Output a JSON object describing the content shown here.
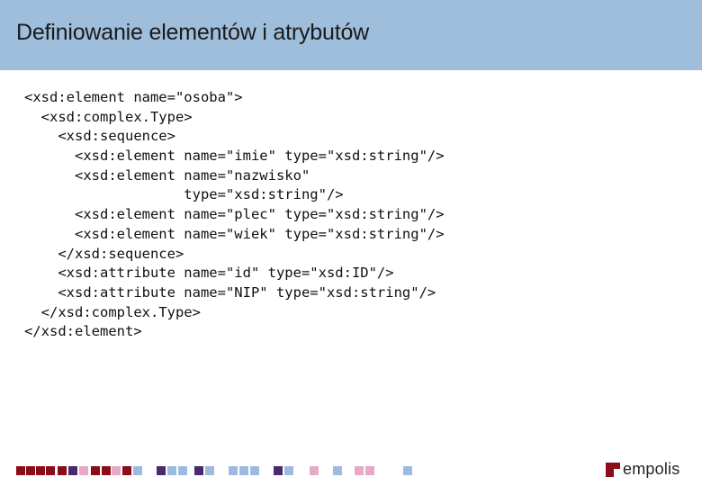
{
  "slide": {
    "title": "Definiowanie elementów i atrybutów",
    "code_lines": [
      "<xsd:element name=\"osoba\">",
      "  <xsd:complex.Type>",
      "    <xsd:sequence>",
      "      <xsd:element name=\"imie\" type=\"xsd:string\"/>",
      "      <xsd:element name=\"nazwisko\"",
      "                   type=\"xsd:string\"/>",
      "      <xsd:element name=\"plec\" type=\"xsd:string\"/>",
      "      <xsd:element name=\"wiek\" type=\"xsd:string\"/>",
      "    </xsd:sequence>",
      "    <xsd:attribute name=\"id\" type=\"xsd:ID\"/>",
      "    <xsd:attribute name=\"NIP\" type=\"xsd:string\"/>",
      "  </xsd:complex.Type>",
      "</xsd:element>"
    ]
  },
  "footer": {
    "logo_text": "empolis",
    "colors": {
      "title_bar": "#9fbedc",
      "square_dark_red": "#8b0d1a",
      "square_purple": "#4a2a6e",
      "square_pink": "#e7a9c6",
      "square_light_blue": "#9dbbe0",
      "logo_red": "#8b0d1a"
    }
  }
}
